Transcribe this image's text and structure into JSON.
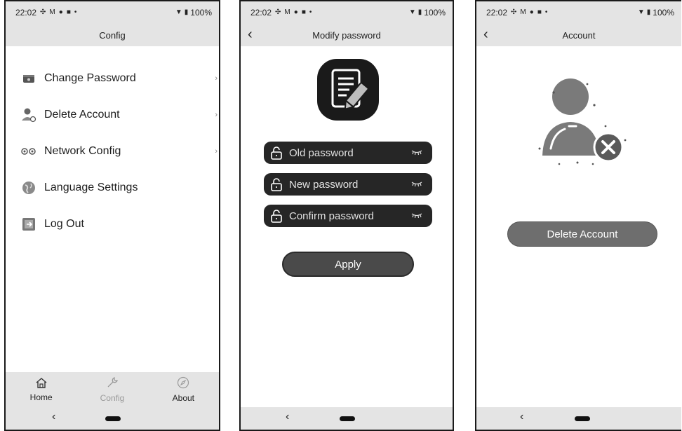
{
  "status": {
    "time": "22:02",
    "battery": "100%",
    "icons": [
      "fan-icon",
      "gmail-icon",
      "record-icon",
      "cast-icon",
      "dot-icon",
      "wifi-icon",
      "battery-icon"
    ]
  },
  "config_screen": {
    "title": "Config",
    "menu": [
      {
        "label": "Change Password",
        "icon": "wallet-icon",
        "has_chevron": true
      },
      {
        "label": "Delete Account",
        "icon": "user-remove-icon",
        "has_chevron": true
      },
      {
        "label": "Network Config",
        "icon": "network-icon",
        "has_chevron": true
      },
      {
        "label": "Language Settings",
        "icon": "globe-icon",
        "has_chevron": false
      },
      {
        "label": "Log Out",
        "icon": "logout-icon",
        "has_chevron": false
      }
    ],
    "chevron": "›",
    "tabs": [
      {
        "label": "Home",
        "icon": "home-icon",
        "active": true
      },
      {
        "label": "Config",
        "icon": "wrench-icon",
        "active": false
      },
      {
        "label": "About",
        "icon": "compass-icon",
        "active": true
      }
    ]
  },
  "password_screen": {
    "title": "Modify password",
    "fields": [
      {
        "placeholder": "Old password",
        "icon": "lock-icon"
      },
      {
        "placeholder": "New password",
        "icon": "lock-icon"
      },
      {
        "placeholder": "Confirm password",
        "icon": "lock-icon"
      }
    ],
    "apply_label": "Apply"
  },
  "account_screen": {
    "title": "Account",
    "delete_label": "Delete Account"
  },
  "nav": {
    "back": "‹",
    "title_back": "‹"
  },
  "colors": {
    "bar": "#e4e4e4",
    "field": "#262626",
    "apply": "#4a4a4a",
    "delete": "#6e6e6e"
  }
}
